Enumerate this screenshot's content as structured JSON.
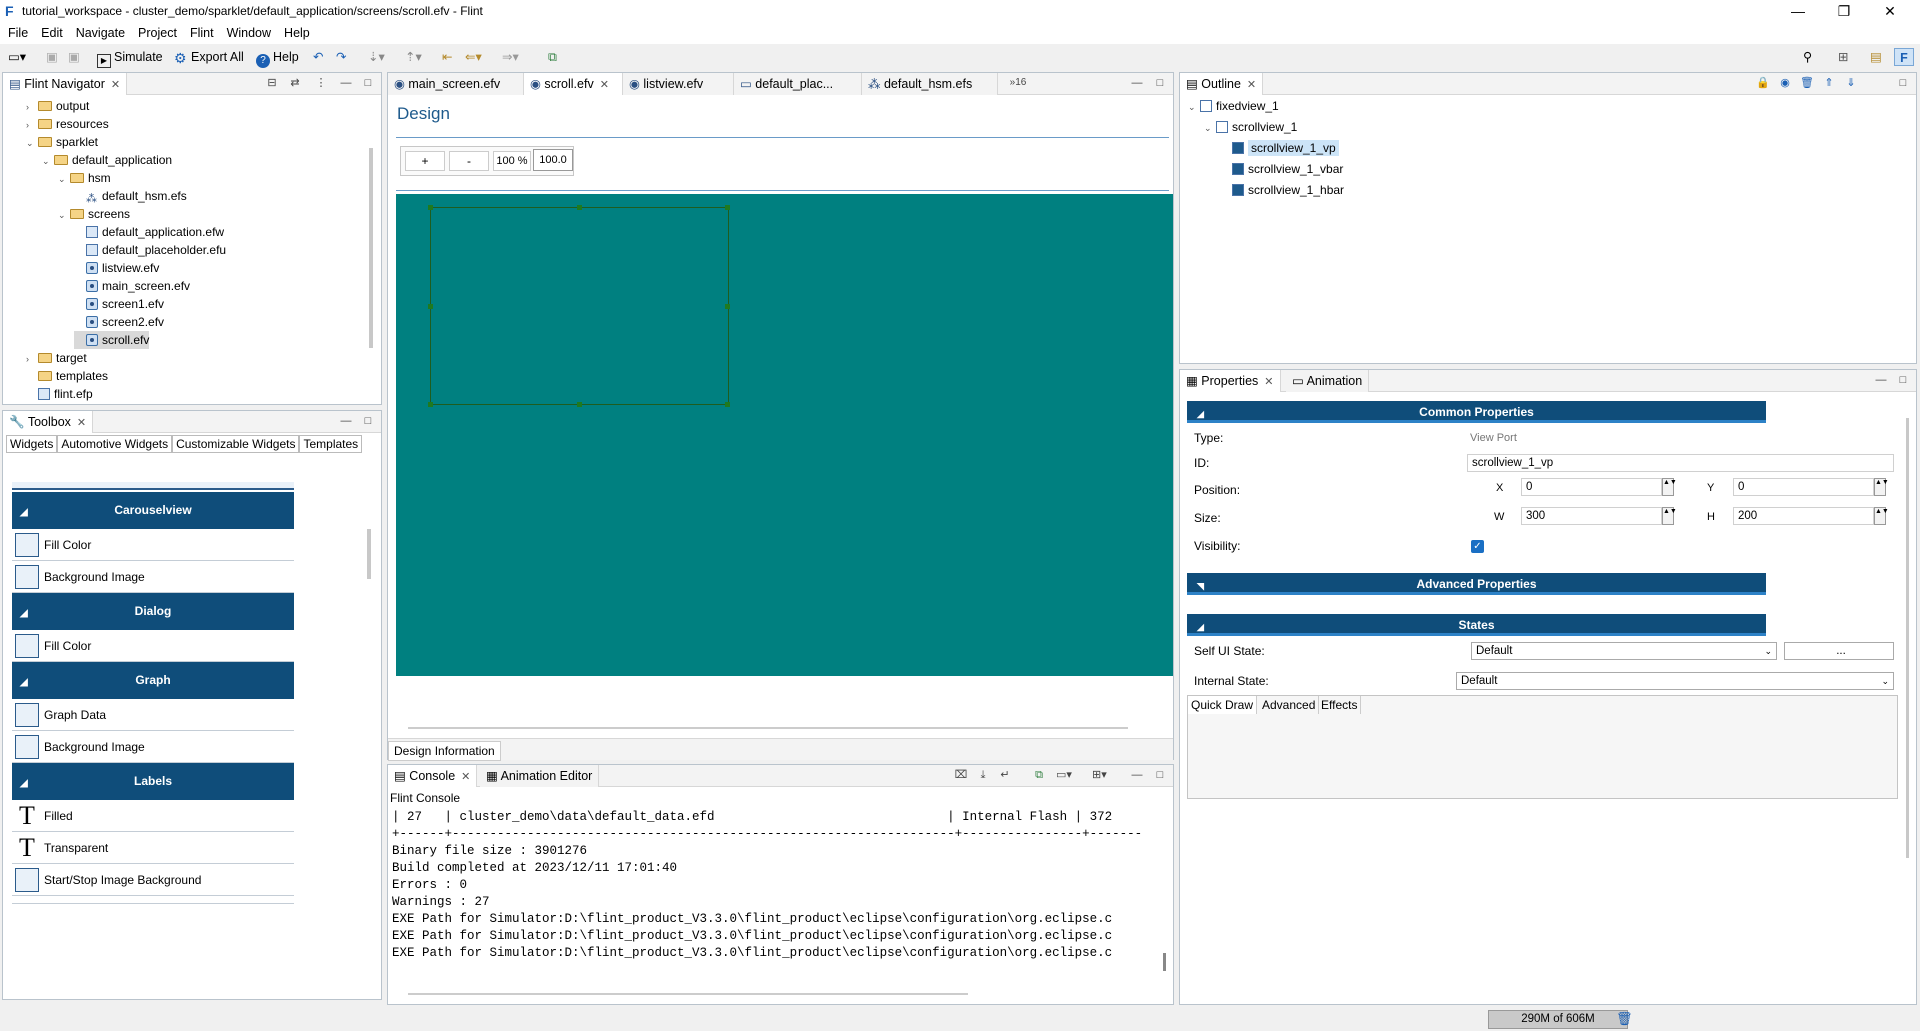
{
  "window": {
    "title": "tutorial_workspace - cluster_demo/sparklet/default_application/screens/scroll.efv - Flint",
    "min": "—",
    "max": "❐",
    "close": "✕"
  },
  "menu": [
    "File",
    "Edit",
    "Navigate",
    "Project",
    "Flint",
    "Window",
    "Help"
  ],
  "toolbar": {
    "simulate": "Simulate",
    "export_all": "Export All",
    "help": "Help"
  },
  "navigator": {
    "title": "Flint Navigator",
    "items": [
      {
        "label": "output",
        "icon": "folder-icon",
        "depth": 1,
        "arrow": "›"
      },
      {
        "label": "resources",
        "icon": "folder-icon",
        "depth": 1,
        "arrow": "›"
      },
      {
        "label": "sparklet",
        "icon": "folder-icon",
        "depth": 1,
        "arrow": "⌄"
      },
      {
        "label": "default_application",
        "icon": "folder-icon",
        "depth": 2,
        "arrow": "⌄"
      },
      {
        "label": "hsm",
        "icon": "folder-icon",
        "depth": 3,
        "arrow": "⌄"
      },
      {
        "label": "default_hsm.efs",
        "icon": "hsm-icon",
        "depth": 4,
        "arrow": ""
      },
      {
        "label": "screens",
        "icon": "folder-icon",
        "depth": 3,
        "arrow": "⌄"
      },
      {
        "label": "default_application.efw",
        "icon": "file-icon",
        "depth": 4,
        "arrow": ""
      },
      {
        "label": "default_placeholder.efu",
        "icon": "file-icon",
        "depth": 4,
        "arrow": ""
      },
      {
        "label": "listview.efv",
        "icon": "eye-icon",
        "depth": 4,
        "arrow": ""
      },
      {
        "label": "main_screen.efv",
        "icon": "eye-icon",
        "depth": 4,
        "arrow": ""
      },
      {
        "label": "screen1.efv",
        "icon": "eye-icon",
        "depth": 4,
        "arrow": ""
      },
      {
        "label": "screen2.efv",
        "icon": "eye-icon",
        "depth": 4,
        "arrow": ""
      },
      {
        "label": "scroll.efv",
        "icon": "eye-icon",
        "depth": 4,
        "arrow": "",
        "selected": true
      },
      {
        "label": "target",
        "icon": "folder-icon",
        "depth": 1,
        "arrow": "›"
      },
      {
        "label": "templates",
        "icon": "folder-icon",
        "depth": 1,
        "arrow": ""
      },
      {
        "label": "flint.efp",
        "icon": "file-icon",
        "depth": 1,
        "arrow": ""
      }
    ]
  },
  "toolbox": {
    "title": "Toolbox",
    "tabs": [
      "Widgets",
      "Automotive Widgets",
      "Customizable Widgets",
      "Templates"
    ],
    "sections": [
      {
        "title": "Carouselview",
        "items": [
          "Fill Color",
          "Background Image"
        ]
      },
      {
        "title": "Dialog",
        "items": [
          "Fill Color"
        ]
      },
      {
        "title": "Graph",
        "items": [
          "Graph Data",
          "Background Image"
        ]
      },
      {
        "title": "Labels",
        "items": [
          "Filled",
          "Transparent",
          "Start/Stop Image Background"
        ]
      }
    ]
  },
  "editor": {
    "tabs": [
      "main_screen.efv",
      "scroll.efv",
      "listview.efv",
      "default_plac...",
      "default_hsm.efs"
    ],
    "overflow": "»16",
    "design_title": "Design",
    "zoom_plus": "+",
    "zoom_minus": "-",
    "zoom_pct": "100 %",
    "zoom_value": "100.0",
    "canvas_color": "#008080",
    "bottom_tab": "Design Information"
  },
  "outline": {
    "title": "Outline",
    "items": [
      {
        "label": "fixedview_1",
        "depth": 0
      },
      {
        "label": "scrollview_1",
        "depth": 1
      },
      {
        "label": "scrollview_1_vp",
        "depth": 2,
        "selected": true
      },
      {
        "label": "scrollview_1_vbar",
        "depth": 2
      },
      {
        "label": "scrollview_1_hbar",
        "depth": 2
      }
    ]
  },
  "properties": {
    "tab": "Properties",
    "tab2": "Animation",
    "common_title": "Common Properties",
    "type_label": "Type:",
    "type_value": "View Port",
    "id_label": "ID:",
    "id_value": "scrollview_1_vp",
    "position_label": "Position:",
    "x_label": "X",
    "x_value": "0",
    "y_label": "Y",
    "y_value": "0",
    "size_label": "Size:",
    "w_label": "W",
    "w_value": "300",
    "h_label": "H",
    "h_value": "200",
    "visibility_label": "Visibility:",
    "advanced_title": "Advanced Properties",
    "states_title": "States",
    "self_ui_label": "Self UI State:",
    "self_ui_value": "Default",
    "ellipsis": "...",
    "internal_label": "Internal State:",
    "internal_value": "Default",
    "subtabs": [
      "Quick Draw",
      "Advanced",
      "Effects"
    ]
  },
  "console": {
    "tab": "Console",
    "tab2": "Animation Editor",
    "name": "Flint Console",
    "lines": [
      "| 27   | cluster_demo\\data\\default_data.efd                               | Internal Flash | 372",
      "+------+-------------------------------------------------------------------+----------------+-------",
      "Binary file size : 3901276",
      "Build completed at 2023/12/11 17:01:40",
      "Errors : 0",
      "Warnings : 27",
      "EXE Path for Simulator:D:\\flint_product_V3.3.0\\flint_product\\eclipse\\configuration\\org.eclipse.c",
      "EXE Path for Simulator:D:\\flint_product_V3.3.0\\flint_product\\eclipse\\configuration\\org.eclipse.c",
      "EXE Path for Simulator:D:\\flint_product_V3.3.0\\flint_product\\eclipse\\configuration\\org.eclipse.c"
    ]
  },
  "status": {
    "memory": "290M of 606M"
  }
}
